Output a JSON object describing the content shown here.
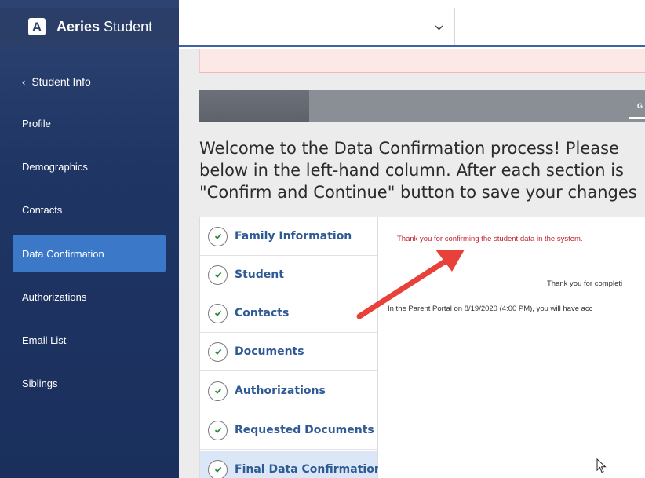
{
  "app": {
    "brand_bold": "Aeries",
    "brand_light": " Student",
    "logo_letter": "A"
  },
  "sidebar": {
    "back_label": "Student Info",
    "items": [
      {
        "label": "Profile"
      },
      {
        "label": "Demographics"
      },
      {
        "label": "Contacts"
      },
      {
        "label": "Data Confirmation"
      },
      {
        "label": "Authorizations"
      },
      {
        "label": "Email List"
      },
      {
        "label": "Siblings"
      }
    ],
    "active_index": 3
  },
  "topbar": {
    "student_select_value": ""
  },
  "tabs": {
    "visible_label": "G"
  },
  "welcome": {
    "line1": "Welcome to the Data Confirmation process! Please",
    "line2": "below in the left-hand column. After each section is",
    "line3": "\"Confirm and Continue\" button to save your changes"
  },
  "steps": [
    {
      "label": "Family Information",
      "confirmed": true
    },
    {
      "label": "Student",
      "confirmed": true
    },
    {
      "label": "Contacts",
      "confirmed": true
    },
    {
      "label": "Documents",
      "confirmed": true
    },
    {
      "label": "Authorizations",
      "confirmed": true
    },
    {
      "label": "Requested Documents",
      "confirmed": true
    },
    {
      "label": "Final Data Confirmation",
      "confirmed": true,
      "active": true
    }
  ],
  "content": {
    "thanks_message": "Thank you for confirming the student data in the system.",
    "thanks_center": "Thank you for completi",
    "portal_line": "In the Parent Portal on 8/19/2020 (4:00 PM), you will have acc"
  },
  "colors": {
    "sidebar_bg": "#1f3564",
    "active_nav": "#3c78c8",
    "step_text": "#2f5a95",
    "message_red": "#c0202c",
    "annotation_arrow": "#e8413a"
  }
}
